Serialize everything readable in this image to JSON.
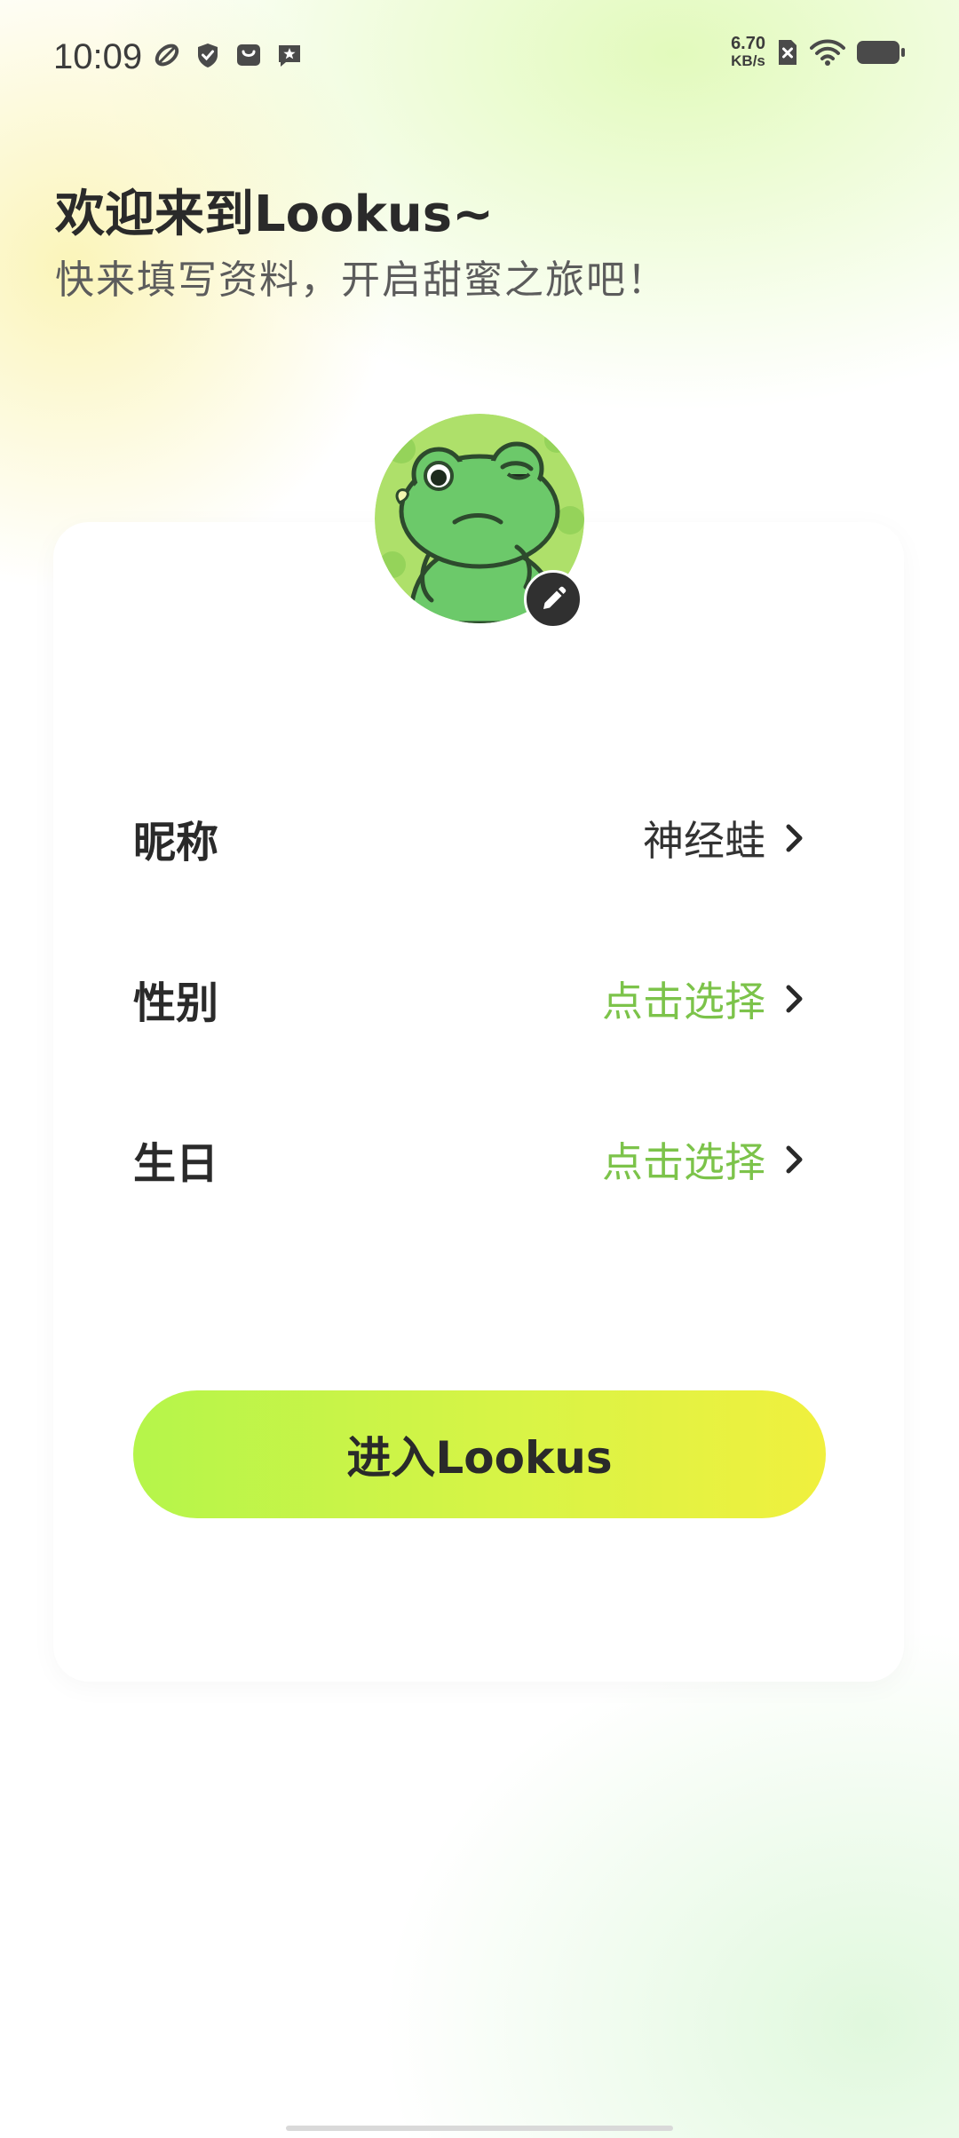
{
  "status_bar": {
    "time": "10:09",
    "net_speed_value": "6.70",
    "net_speed_unit": "KB/s",
    "left_icons": [
      "leaf-icon",
      "shield-check-icon",
      "shopping-bag-icon",
      "star-message-icon"
    ],
    "right_icons": [
      "no-sim-icon",
      "wifi-icon",
      "battery-icon"
    ]
  },
  "header": {
    "title": "欢迎来到Lookus~",
    "subtitle": "快来填写资料，开启甜蜜之旅吧！"
  },
  "profile": {
    "avatar_icon": "frog-avatar-icon",
    "edit_icon": "pencil-icon",
    "rows": [
      {
        "label": "昵称",
        "value": "神经蛙",
        "is_placeholder": false
      },
      {
        "label": "性别",
        "value": "点击选择",
        "is_placeholder": true
      },
      {
        "label": "生日",
        "value": "点击选择",
        "is_placeholder": true
      }
    ]
  },
  "actions": {
    "enter_label": "进入Lookus"
  },
  "colors": {
    "accent_green": "#7cc34a",
    "button_gradient_start": "#b5f54a",
    "button_gradient_end": "#f0f03e",
    "text_dark": "#2a2a2a"
  }
}
